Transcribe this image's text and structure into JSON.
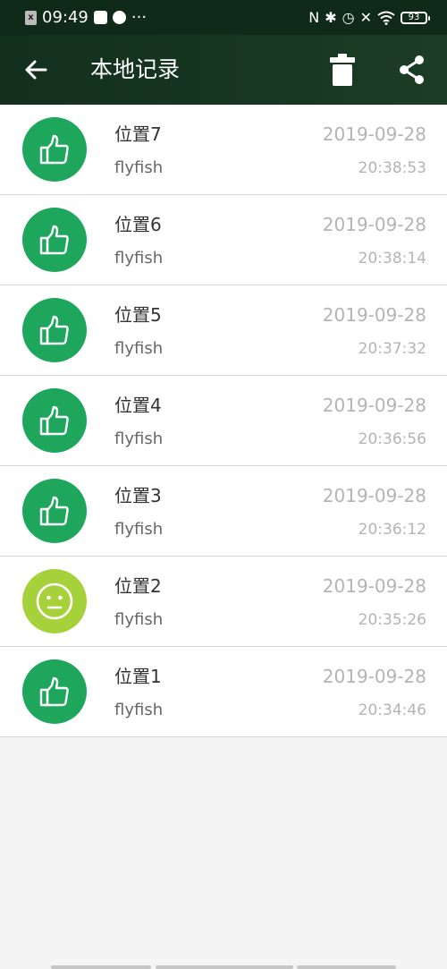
{
  "status_bar": {
    "time": "09:49",
    "dots": "···",
    "battery": "93",
    "sim_icon": "sim-icon",
    "nfc_icon": "nfc-icon",
    "bluetooth_icon": "bluetooth-icon",
    "alarm_icon": "alarm-icon",
    "mute_icon": "mute-icon",
    "wifi_icon": "wifi-icon"
  },
  "appbar": {
    "title": "本地记录",
    "back_icon": "arrow-left-icon",
    "delete_icon": "trash-icon",
    "share_icon": "share-icon"
  },
  "colors": {
    "good": "#1ea75c",
    "neutral": "#a6d13b",
    "appbar": "#12301c"
  },
  "records": [
    {
      "name": "位置7",
      "user": "flyfish",
      "date": "2019-09-28",
      "time": "20:38:53",
      "rating": "good",
      "icon": "thumbs-up-icon"
    },
    {
      "name": "位置6",
      "user": "flyfish",
      "date": "2019-09-28",
      "time": "20:38:14",
      "rating": "good",
      "icon": "thumbs-up-icon"
    },
    {
      "name": "位置5",
      "user": "flyfish",
      "date": "2019-09-28",
      "time": "20:37:32",
      "rating": "good",
      "icon": "thumbs-up-icon"
    },
    {
      "name": "位置4",
      "user": "flyfish",
      "date": "2019-09-28",
      "time": "20:36:56",
      "rating": "good",
      "icon": "thumbs-up-icon"
    },
    {
      "name": "位置3",
      "user": "flyfish",
      "date": "2019-09-28",
      "time": "20:36:12",
      "rating": "good",
      "icon": "thumbs-up-icon"
    },
    {
      "name": "位置2",
      "user": "flyfish",
      "date": "2019-09-28",
      "time": "20:35:26",
      "rating": "neutral",
      "icon": "neutral-face-icon"
    },
    {
      "name": "位置1",
      "user": "flyfish",
      "date": "2019-09-28",
      "time": "20:34:46",
      "rating": "good",
      "icon": "thumbs-up-icon"
    }
  ]
}
